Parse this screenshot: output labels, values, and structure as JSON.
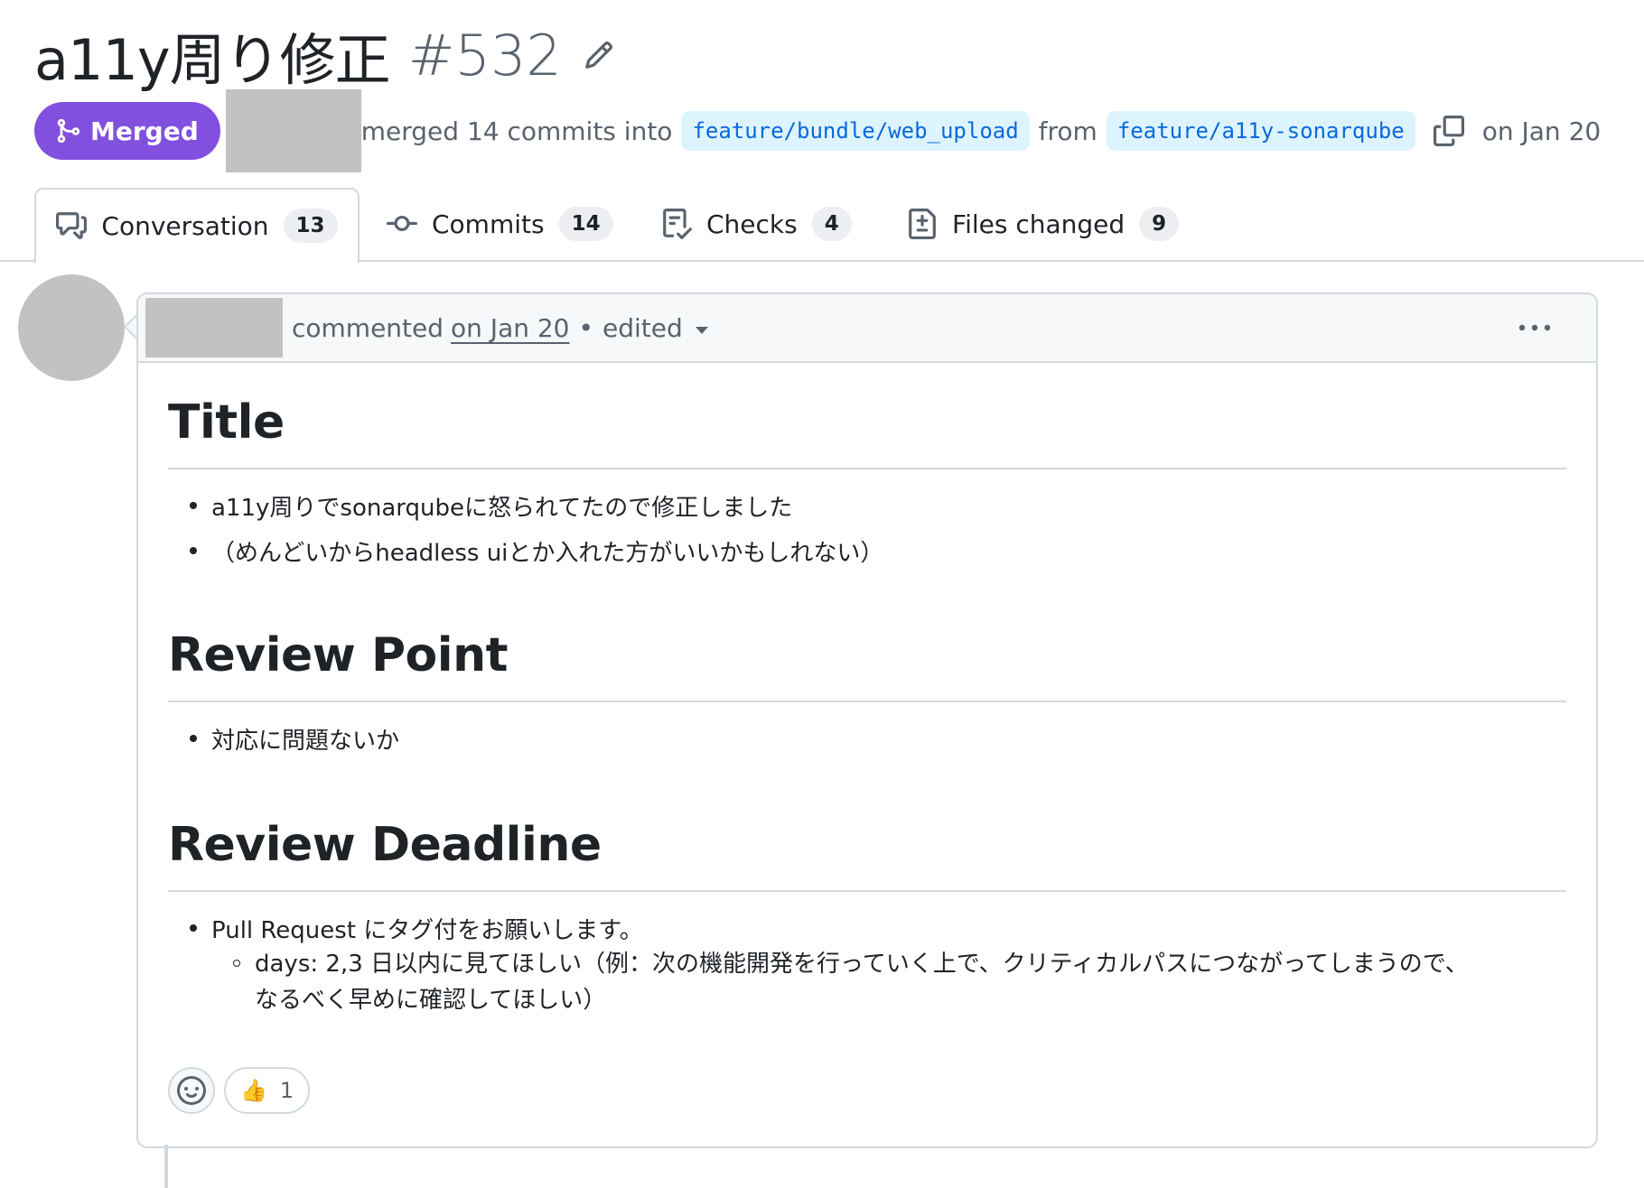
{
  "pr": {
    "title": "a11y周り修正",
    "number": "#532",
    "status": "Merged",
    "merge_text": "merged 14 commits into",
    "base_branch": "feature/bundle/web_upload",
    "from_text": "from",
    "head_branch": "feature/a11y-sonarqube",
    "date_text": "on Jan 20"
  },
  "tabs": [
    {
      "label": "Conversation",
      "count": "13",
      "icon": "comment-discussion-icon"
    },
    {
      "label": "Commits",
      "count": "14",
      "icon": "git-commit-icon"
    },
    {
      "label": "Checks",
      "count": "4",
      "icon": "checklist-icon"
    },
    {
      "label": "Files changed",
      "count": "9",
      "icon": "file-diff-icon"
    }
  ],
  "comment": {
    "action": "commented",
    "date": "on Jan 20",
    "separator": "•",
    "edited": "edited",
    "sections": [
      {
        "heading": "Title",
        "items": [
          "a11y周りでsonarqubeに怒られてたので修正しました",
          "（めんどいからheadless uiとか入れた方がいいかもしれない）"
        ]
      },
      {
        "heading": "Review Point",
        "items": [
          "対応に問題ないか"
        ]
      },
      {
        "heading": "Review Deadline",
        "items": [
          "Pull Request にタグ付をお願いします。"
        ],
        "subitem_line1": "days: 2,3 日以内に見てほしい（例：次の機能開発を行っていく上で、クリティカルパスにつながってしまうので、",
        "subitem_line2": "なるべく早めに確認してほしい）"
      }
    ],
    "reactions": [
      {
        "emoji": "👍",
        "count": "1"
      }
    ]
  },
  "colors": {
    "merged": "#8250df",
    "link": "#0969da",
    "branch_bg": "#ddf4ff",
    "border": "#d1d9e0",
    "muted": "#59636e"
  }
}
